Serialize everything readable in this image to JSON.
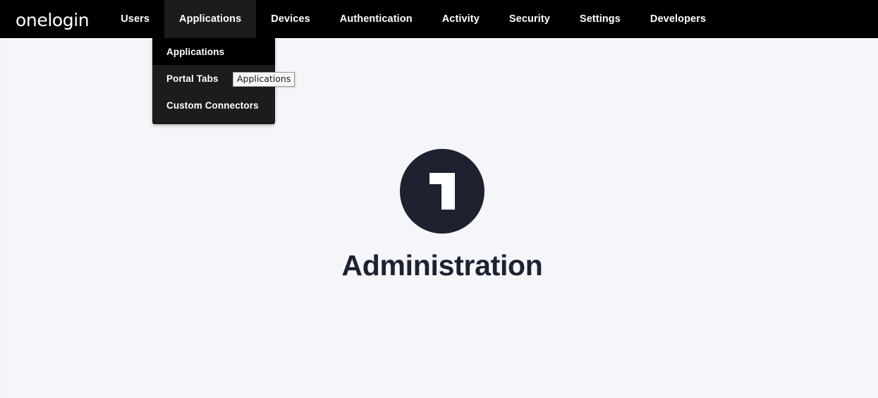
{
  "brand": {
    "logo_text": "onelogin",
    "colors": {
      "nav_background": "#000000",
      "nav_active": "#1c1c1c",
      "page_background": "#f5f6f9",
      "badge": "#1e2130",
      "heading": "#1e2130",
      "nav_text": "#ffffff"
    }
  },
  "navbar": {
    "items": [
      {
        "label": "Users",
        "active": false
      },
      {
        "label": "Applications",
        "active": true
      },
      {
        "label": "Devices",
        "active": false
      },
      {
        "label": "Authentication",
        "active": false
      },
      {
        "label": "Activity",
        "active": false
      },
      {
        "label": "Security",
        "active": false
      },
      {
        "label": "Settings",
        "active": false
      },
      {
        "label": "Developers",
        "active": false
      }
    ]
  },
  "dropdown": {
    "parent": "Applications",
    "items": [
      {
        "label": "Applications",
        "selected": true
      },
      {
        "label": "Portal Tabs",
        "selected": false
      },
      {
        "label": "Custom Connectors",
        "selected": false
      }
    ]
  },
  "tooltip": {
    "text": "Applications"
  },
  "main": {
    "badge": {
      "numeral": "1",
      "icon_name": "onelogin-one-badge"
    },
    "title": "Administration"
  }
}
